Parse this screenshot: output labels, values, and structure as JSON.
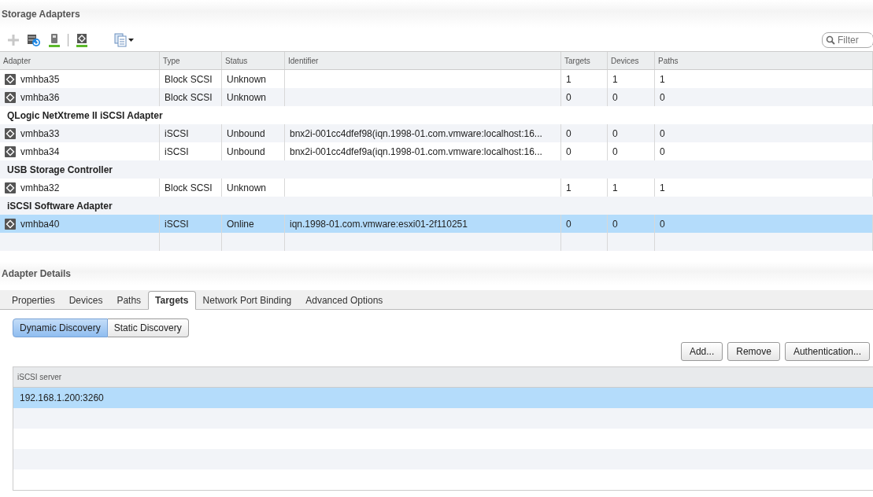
{
  "section_title": "Storage Adapters",
  "filter": {
    "placeholder": "Filter"
  },
  "table": {
    "columns": [
      "Adapter",
      "Type",
      "Status",
      "Identifier",
      "Targets",
      "Devices",
      "Paths"
    ],
    "rows": [
      {
        "kind": "adapter",
        "selected": false,
        "cells": [
          "vmhba35",
          "Block SCSI",
          "Unknown",
          "",
          "1",
          "1",
          "1"
        ]
      },
      {
        "kind": "adapter",
        "selected": false,
        "cells": [
          "vmhba36",
          "Block SCSI",
          "Unknown",
          "",
          "0",
          "0",
          "0"
        ]
      },
      {
        "kind": "group",
        "label": "QLogic NetXtreme II iSCSI Adapter"
      },
      {
        "kind": "adapter",
        "selected": false,
        "cells": [
          "vmhba33",
          "iSCSI",
          "Unbound",
          "bnx2i-001cc4dfef98(iqn.1998-01.com.vmware:localhost:16...",
          "0",
          "0",
          "0"
        ]
      },
      {
        "kind": "adapter",
        "selected": false,
        "cells": [
          "vmhba34",
          "iSCSI",
          "Unbound",
          "bnx2i-001cc4dfef9a(iqn.1998-01.com.vmware:localhost:16...",
          "0",
          "0",
          "0"
        ]
      },
      {
        "kind": "group",
        "label": "USB Storage Controller"
      },
      {
        "kind": "adapter",
        "selected": false,
        "cells": [
          "vmhba32",
          "Block SCSI",
          "Unknown",
          "",
          "1",
          "1",
          "1"
        ]
      },
      {
        "kind": "group",
        "label": "iSCSI Software Adapter"
      },
      {
        "kind": "adapter",
        "selected": true,
        "cells": [
          "vmhba40",
          "iSCSI",
          "Online",
          "iqn.1998-01.com.vmware:esxi01-2f110251",
          "0",
          "0",
          "0"
        ]
      }
    ]
  },
  "details_title": "Adapter Details",
  "tabs": [
    {
      "label": "Properties",
      "selected": false
    },
    {
      "label": "Devices",
      "selected": false
    },
    {
      "label": "Paths",
      "selected": false
    },
    {
      "label": "Targets",
      "selected": true
    },
    {
      "label": "Network Port Binding",
      "selected": false
    },
    {
      "label": "Advanced Options",
      "selected": false
    }
  ],
  "discovery": [
    {
      "label": "Dynamic Discovery",
      "selected": true
    },
    {
      "label": "Static Discovery",
      "selected": false
    }
  ],
  "actions": [
    "Add...",
    "Remove",
    "Authentication..."
  ],
  "servers": {
    "column": "iSCSI server",
    "rows": [
      {
        "address": "192.168.1.200:3260",
        "selected": true
      }
    ]
  }
}
